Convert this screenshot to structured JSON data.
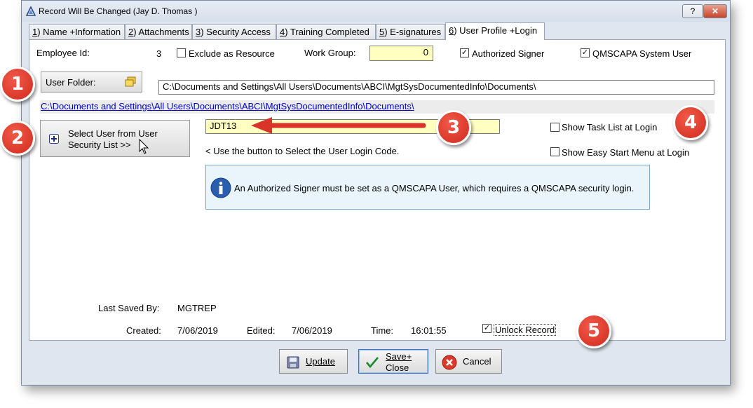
{
  "window": {
    "title": "Record Will Be Changed  (Jay D. Thomas                    )",
    "help_label": "?",
    "close_label": "✕"
  },
  "tabs": [
    {
      "num": "1",
      "label": ") Name +Information"
    },
    {
      "num": "2",
      "label": ") Attachments"
    },
    {
      "num": "3",
      "label": ") Security Access"
    },
    {
      "num": "4",
      "label": ") Training Completed"
    },
    {
      "num": "5",
      "label": ") E-signatures"
    },
    {
      "num": "6",
      "label": ") User Profile +Login"
    }
  ],
  "form": {
    "employee_id_label": "Employee Id:",
    "employee_id_value": "3",
    "exclude_resource_label": "Exclude as Resource",
    "work_group_label": "Work Group:",
    "work_group_value": "0",
    "authorized_signer_label": "Authorized Signer",
    "system_user_label": "QMSCAPA System User",
    "user_folder_label": "User Folder:",
    "user_folder_path": "C:\\Documents and Settings\\All Users\\Documents\\ABCI\\MgtSysDocumentedInfo\\Documents\\",
    "user_folder_link": "C:\\Documents and Settings\\All Users\\Documents\\ABCI\\MgtSysDocumentedInfo\\Documents\\",
    "select_user_label_1": "Select User from User",
    "select_user_label_2": "Security List >>",
    "login_code_value": "JDT13",
    "hint_text": "<  Use the button to Select the User Login Code.",
    "show_task_list_label": "Show Task List at Login",
    "show_easy_start_label": "Show Easy Start Menu at Login",
    "info_message": "An Authorized Signer must be set as a QMSCAPA User, which requires a QMSCAPA security login."
  },
  "footer": {
    "last_saved_label": "Last Saved By:",
    "last_saved_value": "MGTREP",
    "created_label": "Created:",
    "created_value": "7/06/2019",
    "edited_label": "Edited:",
    "edited_value": "7/06/2019",
    "time_label": "Time:",
    "time_value": "16:01:55",
    "unlock_label": "Unlock Record"
  },
  "buttons": {
    "update": "Update",
    "save_1": "Save+",
    "save_2": "Close",
    "cancel": "Cancel"
  },
  "badges": [
    "1",
    "2",
    "3",
    "4",
    "5"
  ],
  "colors": {
    "badge": "#d9342a",
    "yellow_field": "#ffffc0",
    "link": "#0000cc",
    "info_bg": "#eaf4fb"
  }
}
